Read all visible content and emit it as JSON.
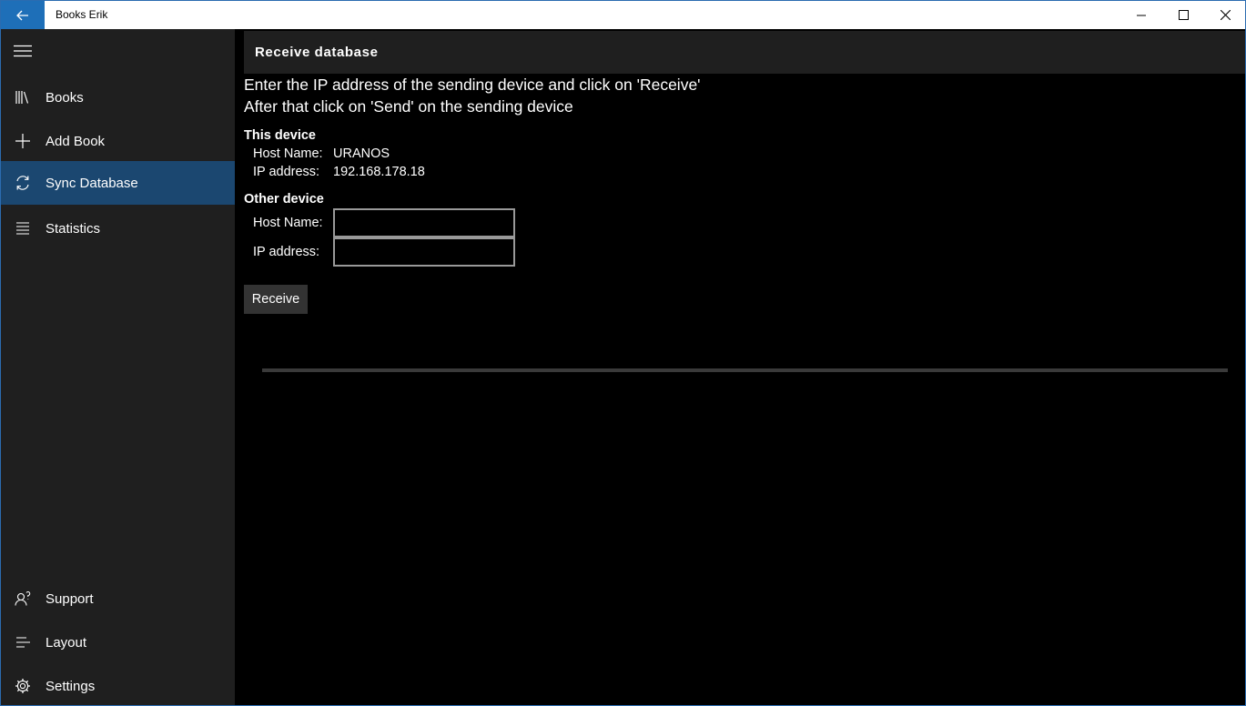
{
  "window": {
    "title": "Books Erik"
  },
  "nav": {
    "items": [
      {
        "label": "Books",
        "icon": "library-icon"
      },
      {
        "label": "Add Book",
        "icon": "plus-icon"
      },
      {
        "label": "Sync Database",
        "icon": "sync-icon",
        "active": true
      },
      {
        "label": "Statistics",
        "icon": "list-icon"
      }
    ],
    "bottom_items": [
      {
        "label": "Support",
        "icon": "contact-support-icon"
      },
      {
        "label": "Layout",
        "icon": "align-left-icon"
      },
      {
        "label": "Settings",
        "icon": "gear-icon"
      }
    ]
  },
  "page": {
    "title": "Receive database",
    "instruction_line1": "Enter the IP address of the sending device and click on 'Receive'",
    "instruction_line2": "After that click on 'Send' on the sending device",
    "this_device": {
      "title": "This device",
      "host_label": "Host Name:",
      "host_value": "URANOS",
      "ip_label": "IP address:",
      "ip_value": "192.168.178.18"
    },
    "other_device": {
      "title": "Other device",
      "host_label": "Host Name:",
      "host_value": "",
      "ip_label": "IP address:",
      "ip_value": ""
    },
    "receive_label": "Receive",
    "progress": 0
  },
  "colors": {
    "accent": "#1e6fb8",
    "nav_active": "#1b4770",
    "sidebar_bg": "#1f1f1f",
    "content_bg": "#000000"
  }
}
